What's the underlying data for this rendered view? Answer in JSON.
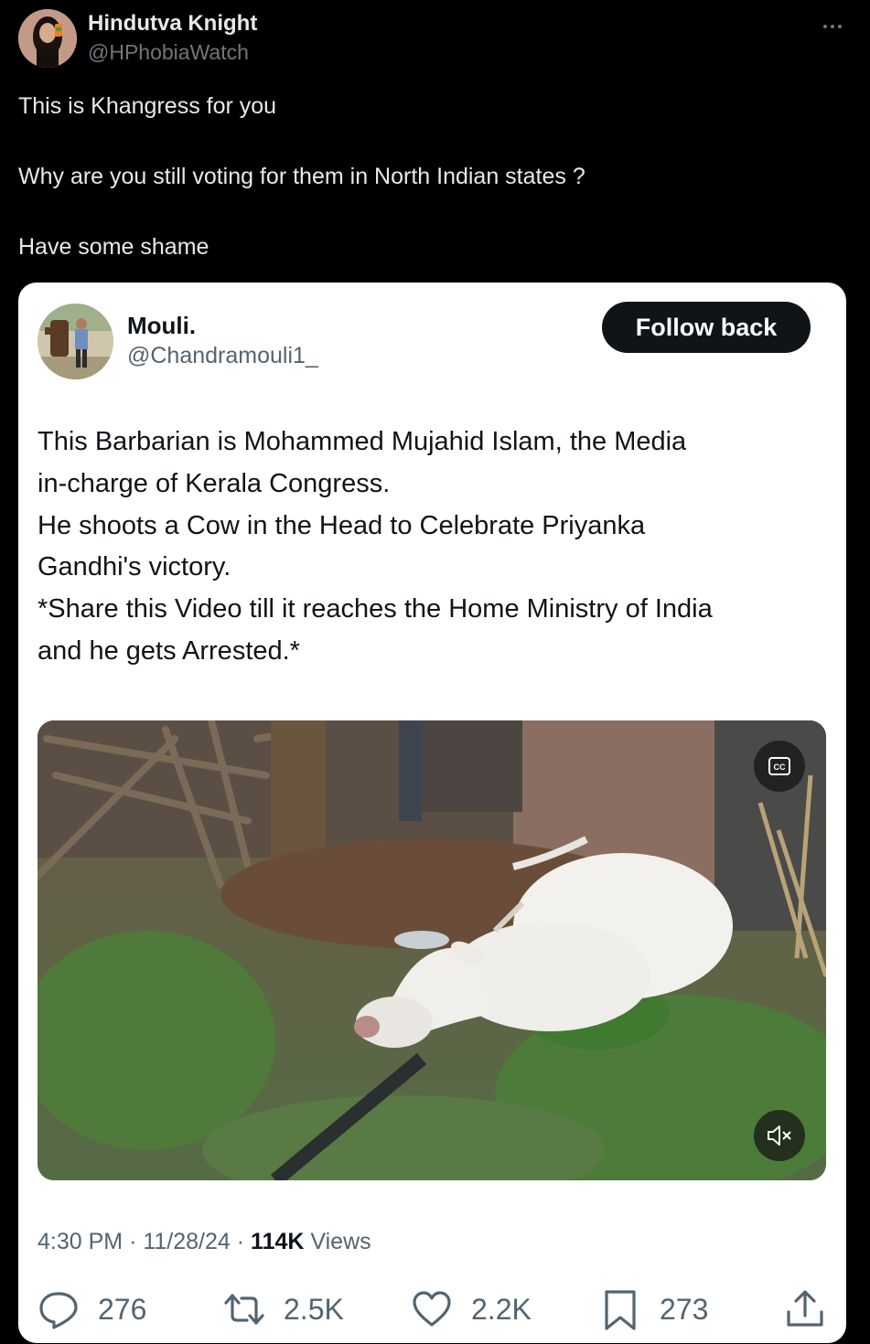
{
  "outer_tweet": {
    "author_name": "Hindutva Knight",
    "author_handle": "@HPhobiaWatch",
    "text_lines": [
      "This is Khangress for you",
      "Why are you still voting for them in North Indian states ?",
      "Have some shame"
    ]
  },
  "quoted_tweet": {
    "author_name": "Mouli.",
    "author_handle": "@Chandramouli1_",
    "follow_label": "Follow back",
    "text_lines": [
      "This Barbarian is Mohammed Mujahid Islam, the Media",
      "in-charge of Kerala Congress.",
      "He shoots a Cow in the Head to Celebrate Priyanka",
      "Gandhi's victory.",
      "*Share this Video till it reaches the Home Ministry of India",
      "and he gets Arrested.*"
    ],
    "video": {
      "cc_label": "CC"
    },
    "time": "4:30 PM",
    "date": "11/28/24",
    "separator": "·",
    "views_count": "114K",
    "views_label": "Views",
    "actions": {
      "replies": "276",
      "reposts": "2.5K",
      "likes": "2.2K",
      "bookmarks": "273"
    }
  },
  "icons": {
    "more": "more-icon",
    "cc": "closed-captions-icon",
    "mute": "muted-speaker-icon",
    "reply": "reply-icon",
    "repost": "repost-icon",
    "like": "heart-icon",
    "bookmark": "bookmark-icon",
    "share": "share-icon"
  },
  "colors": {
    "background": "#000000",
    "card": "#ffffff",
    "primary_text": "#0f1419",
    "secondary_text": "#536471",
    "follow_button": "#0f1419"
  }
}
